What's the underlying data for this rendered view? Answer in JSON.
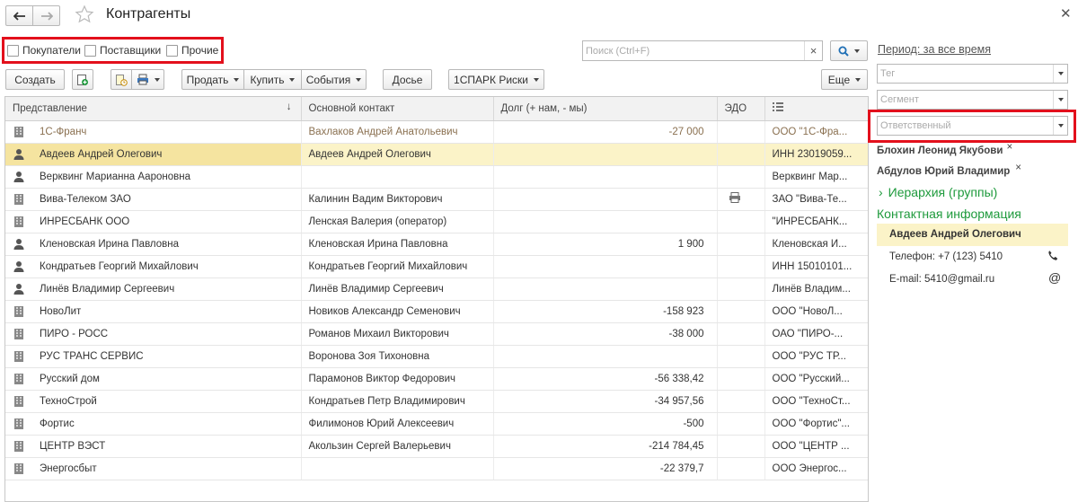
{
  "title": "Контрагенты",
  "nav": {
    "back_icon": "arrow-left-icon",
    "forward_icon": "arrow-right-icon",
    "favorite_icon": "star-icon"
  },
  "filters": {
    "buyers": "Покупатели",
    "suppliers": "Поставщики",
    "other": "Прочие"
  },
  "search": {
    "placeholder": "Поиск (Ctrl+F)",
    "clear": "×"
  },
  "period": "Период: за все время",
  "toolbar": {
    "create": "Создать",
    "sell": "Продать",
    "buy": "Купить",
    "events": "События",
    "dossier": "Досье",
    "spark": "1СПАРК Риски",
    "more": "Еще"
  },
  "table": {
    "headers": {
      "name": "Представление",
      "sort": "↓",
      "contact": "Основной контакт",
      "debt": "Долг (+ нам, - мы)",
      "edo": "ЭДО"
    },
    "rows": [
      {
        "type": "org",
        "name": "1С-Франч",
        "contact": "Вахлаков Андрей Анатольевич",
        "debt": "-27 000",
        "edo": "",
        "extra": "ООО \"1С-Фра...",
        "muted": true
      },
      {
        "type": "person",
        "name": "Авдеев Андрей Олегович",
        "contact": "Авдеев Андрей Олегович",
        "debt": "",
        "edo": "",
        "extra": "ИНН 23019059...",
        "selected": true
      },
      {
        "type": "person",
        "name": "Верквинг Марианна Аароновна",
        "contact": "",
        "debt": "",
        "edo": "",
        "extra": "Верквинг Мар..."
      },
      {
        "type": "org",
        "name": "Вива-Телеком ЗАО",
        "contact": "Калинин Вадим Викторович",
        "debt": "",
        "edo": "edo",
        "extra": "ЗАО \"Вива-Те..."
      },
      {
        "type": "org",
        "name": "ИНРЕСБАНК ООО",
        "contact": "Ленская Валерия (оператор)",
        "debt": "",
        "edo": "",
        "extra": "\"ИНРЕСБАНК..."
      },
      {
        "type": "person",
        "name": "Кленовская Ирина Павловна",
        "contact": "Кленовская Ирина Павловна",
        "debt": "1 900",
        "edo": "",
        "extra": "Кленовская И..."
      },
      {
        "type": "person",
        "name": "Кондратьев Георгий Михайлович",
        "contact": "Кондратьев Георгий Михайлович",
        "debt": "",
        "edo": "",
        "extra": "ИНН 15010101..."
      },
      {
        "type": "person",
        "name": "Линёв Владимир Сергеевич",
        "contact": "Линёв Владимир Сергеевич",
        "debt": "",
        "edo": "",
        "extra": "Линёв Владим..."
      },
      {
        "type": "org",
        "name": "НовоЛит",
        "contact": "Новиков Александр Семенович",
        "debt": "-158 923",
        "edo": "",
        "extra": "ООО \"НовоЛ..."
      },
      {
        "type": "org",
        "name": "ПИРО - РОСС",
        "contact": "Романов Михаил Викторович",
        "debt": "-38 000",
        "edo": "",
        "extra": "ОАО \"ПИРО-..."
      },
      {
        "type": "org",
        "name": "РУС ТРАНС СЕРВИС",
        "contact": "Воронова Зоя Тихоновна",
        "debt": "",
        "edo": "",
        "extra": "ООО \"РУС ТР..."
      },
      {
        "type": "org",
        "name": "Русский дом",
        "contact": "Парамонов Виктор Федорович",
        "debt": "-56 338,42",
        "edo": "",
        "extra": "ООО \"Русский..."
      },
      {
        "type": "org",
        "name": "ТехноСтрой",
        "contact": "Кондратьев Петр Владимирович",
        "debt": "-34 957,56",
        "edo": "",
        "extra": "ООО \"ТехноСт..."
      },
      {
        "type": "org",
        "name": "Фортис",
        "contact": "Филимонов Юрий Алексеевич",
        "debt": "-500",
        "edo": "",
        "extra": "ООО \"Фортис\"..."
      },
      {
        "type": "org",
        "name": "ЦЕНТР ВЭСТ",
        "contact": "Акользин Сергей Валерьевич",
        "debt": "-214 784,45",
        "edo": "",
        "extra": "ООО \"ЦЕНТР ..."
      },
      {
        "type": "org",
        "name": "Энергосбыт",
        "contact": "",
        "debt": "-22 379,7",
        "edo": "",
        "extra": "ООО Энергос..."
      }
    ]
  },
  "side": {
    "tag_placeholder": "Тег",
    "segment_placeholder": "Сегмент",
    "responsible_placeholder": "Ответственный",
    "responsibles": [
      "Блохин Леонид Якубови",
      "Абдулов Юрий Владимир"
    ],
    "hierarchy": "Иерархия (группы)",
    "contact_info": "Контактная информация",
    "selected_name": "Авдеев Андрей Олегович",
    "phone": "Телефон: +7 (123) 5410",
    "email": "E-mail: 5410@gmail.ru"
  },
  "colors": {
    "accent_green": "#1e9a3c",
    "highlight": "#e3101c",
    "selected_row": "#fbf3c8"
  }
}
